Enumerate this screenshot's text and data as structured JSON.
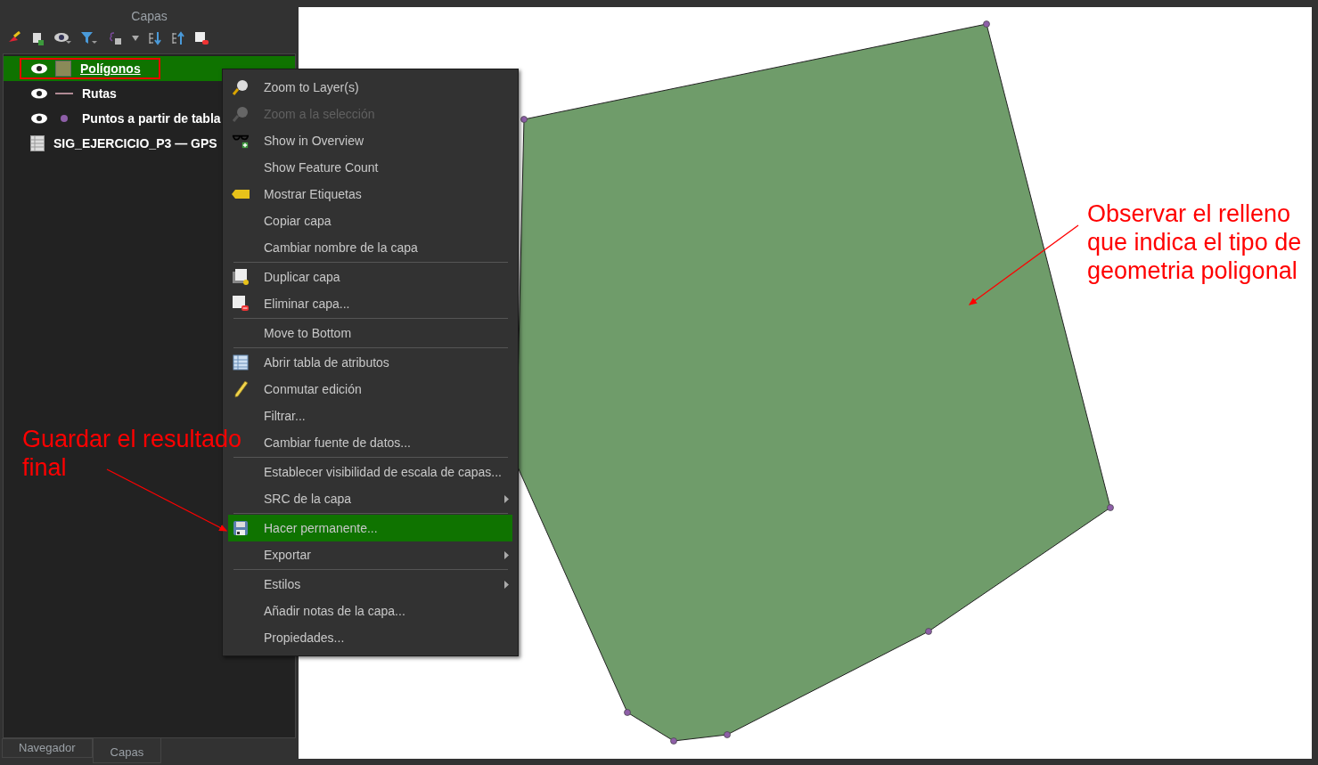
{
  "panel": {
    "title": "Capas"
  },
  "layers": [
    {
      "name": "Polígonos",
      "visible": true,
      "kind": "fill",
      "color": "#8a8a58",
      "selected": true
    },
    {
      "name": "Rutas",
      "visible": true,
      "kind": "line",
      "color": "#b08a94",
      "selected": false
    },
    {
      "name": "Puntos a partir de tabla",
      "visible": true,
      "kind": "point",
      "color": "#8e5fa8",
      "selected": false
    },
    {
      "name": "SIG_EJERCICIO_P3 — GPS",
      "visible": false,
      "kind": "table",
      "selected": false
    }
  ],
  "bottom_tabs": [
    {
      "label": "Navegador",
      "selected": false
    },
    {
      "label": "Capas",
      "selected": true
    }
  ],
  "context_menu": [
    {
      "kind": "item",
      "label": "Zoom to Layer(s)",
      "disabled": false,
      "selected": false,
      "submenu": false
    },
    {
      "kind": "item",
      "label": "Zoom a la selección",
      "disabled": true,
      "selected": false,
      "submenu": false
    },
    {
      "kind": "item",
      "label": "Show in Overview",
      "disabled": false,
      "selected": false,
      "submenu": false
    },
    {
      "kind": "item",
      "label": "Show Feature Count",
      "disabled": false,
      "selected": false,
      "submenu": false
    },
    {
      "kind": "item",
      "label": "Mostrar Etiquetas",
      "disabled": false,
      "selected": false,
      "submenu": false
    },
    {
      "kind": "item",
      "label": "Copiar capa",
      "disabled": false,
      "selected": false,
      "submenu": false
    },
    {
      "kind": "item",
      "label": "Cambiar nombre de la capa",
      "disabled": false,
      "selected": false,
      "submenu": false
    },
    {
      "kind": "separator"
    },
    {
      "kind": "item",
      "label": "Duplicar capa",
      "disabled": false,
      "selected": false,
      "submenu": false
    },
    {
      "kind": "item",
      "label": "Eliminar capa...",
      "disabled": false,
      "selected": false,
      "submenu": false
    },
    {
      "kind": "separator"
    },
    {
      "kind": "item",
      "label": "Move to Bottom",
      "disabled": false,
      "selected": false,
      "submenu": false
    },
    {
      "kind": "separator"
    },
    {
      "kind": "item",
      "label": "Abrir tabla de atributos",
      "disabled": false,
      "selected": false,
      "submenu": false
    },
    {
      "kind": "item",
      "label": "Conmutar edición",
      "disabled": false,
      "selected": false,
      "submenu": false
    },
    {
      "kind": "item",
      "label": "Filtrar...",
      "disabled": false,
      "selected": false,
      "submenu": false
    },
    {
      "kind": "item",
      "label": "Cambiar fuente de datos...",
      "disabled": false,
      "selected": false,
      "submenu": false
    },
    {
      "kind": "separator"
    },
    {
      "kind": "item",
      "label": "Establecer visibilidad de escala de capas...",
      "disabled": false,
      "selected": false,
      "submenu": false
    },
    {
      "kind": "item",
      "label": "SRC de la capa",
      "disabled": false,
      "selected": false,
      "submenu": true
    },
    {
      "kind": "separator"
    },
    {
      "kind": "item",
      "label": "Hacer permanente...",
      "disabled": false,
      "selected": true,
      "submenu": false
    },
    {
      "kind": "item",
      "label": "Exportar",
      "disabled": false,
      "selected": false,
      "submenu": true
    },
    {
      "kind": "separator"
    },
    {
      "kind": "item",
      "label": "Estilos",
      "disabled": false,
      "selected": false,
      "submenu": true
    },
    {
      "kind": "item",
      "label": "Añadir notas de la capa...",
      "disabled": false,
      "selected": false,
      "submenu": false
    },
    {
      "kind": "item",
      "label": "Propiedades...",
      "disabled": false,
      "selected": false,
      "submenu": false
    }
  ],
  "annotations": [
    {
      "kind": "map",
      "text": "Observar el relleno que indica el tipo de geometria poligonal"
    },
    {
      "kind": "panel",
      "text": "Guardar el resultado final"
    }
  ]
}
